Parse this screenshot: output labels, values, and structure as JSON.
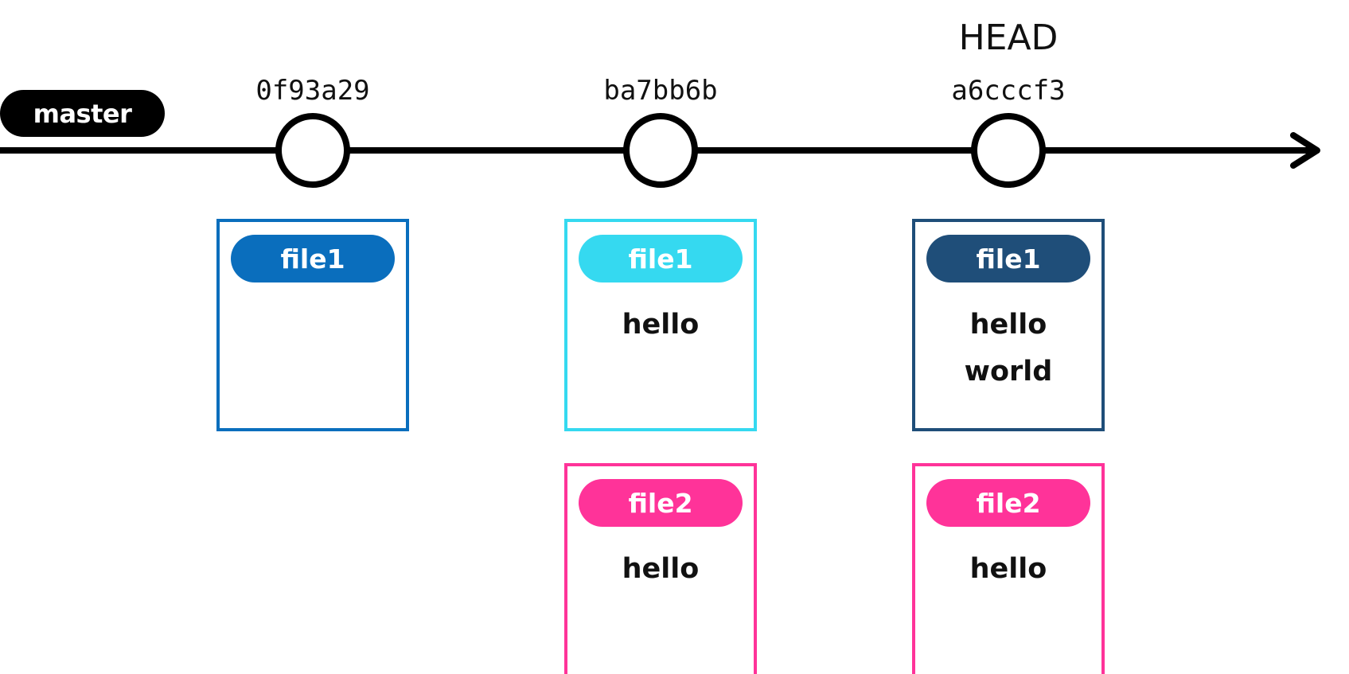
{
  "branch": {
    "label": "master",
    "color": "#000000"
  },
  "head": {
    "label": "HEAD"
  },
  "commits": [
    {
      "hash": "0f93a29",
      "files": [
        {
          "name": "file1",
          "color": "#0A6EBD",
          "lines": []
        }
      ]
    },
    {
      "hash": "ba7bb6b",
      "files": [
        {
          "name": "file1",
          "color": "#35D9F0",
          "lines": [
            "hello"
          ]
        },
        {
          "name": "file2",
          "color": "#FF3399",
          "lines": [
            "hello"
          ]
        }
      ]
    },
    {
      "hash": "a6cccf3",
      "files": [
        {
          "name": "file1",
          "color": "#1F4E79",
          "lines": [
            "hello",
            "world"
          ]
        },
        {
          "name": "file2",
          "color": "#FF3399",
          "lines": [
            "hello"
          ]
        }
      ]
    }
  ]
}
